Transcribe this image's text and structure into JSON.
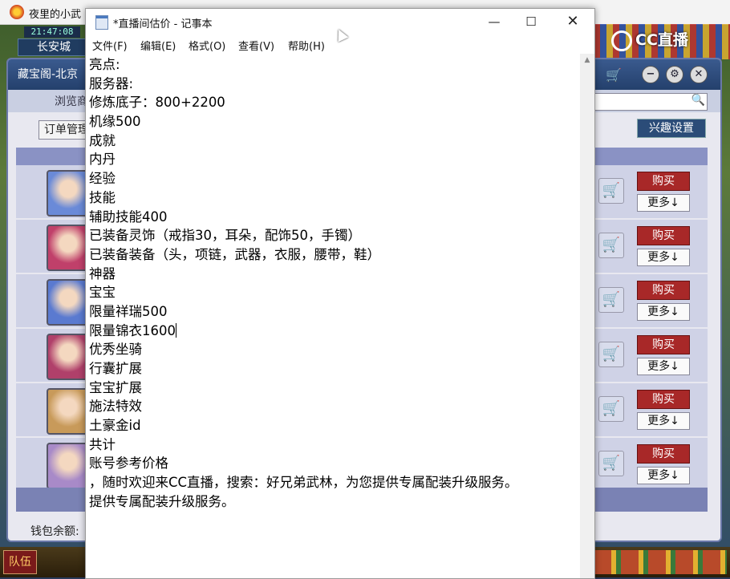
{
  "game": {
    "window_title": "夜里的小武",
    "clock": "21:47:08",
    "city": "长安城",
    "cc_logo": "CC直播",
    "shop": {
      "title": "藏宝阁-北京",
      "browse_label": "浏览商",
      "order_button": "订单管理",
      "interest_button": "兴趣设置",
      "buy_label": "购买",
      "more_label": "更多↓",
      "wallet_label": "钱包余额:",
      "avatar_colors": [
        "#6a8ad8",
        "#c0406a",
        "#5a7ad0",
        "#b0406a",
        "#c89a5a",
        "#a88ac8"
      ]
    },
    "bottom": {
      "team_button": "队伍"
    }
  },
  "notepad": {
    "title": "*直播间估价 - 记事本",
    "menu": [
      "文件(F)",
      "编辑(E)",
      "格式(O)",
      "查看(V)",
      "帮助(H)"
    ],
    "lines": [
      "亮点:",
      "服务器:",
      "修炼底子：800+2200",
      "机缘500",
      "成就",
      "内丹",
      "经验",
      "技能",
      "辅助技能400",
      "已装备灵饰（戒指30，耳朵，配饰50，手镯）",
      "已装备装备（头，项链，武器，衣服，腰带，鞋）",
      "神器",
      "宝宝",
      "限量祥瑞500",
      "限量锦衣1600",
      "优秀坐骑",
      "行囊扩展",
      "宝宝扩展",
      "施法特效",
      "土豪金id",
      "共计",
      "账号参考价格",
      "，随时欢迎来CC直播，搜索：好兄弟武林，为您提供专属配装升级服务。",
      "提供专属配装升级服务。"
    ],
    "caret_line": 14
  }
}
